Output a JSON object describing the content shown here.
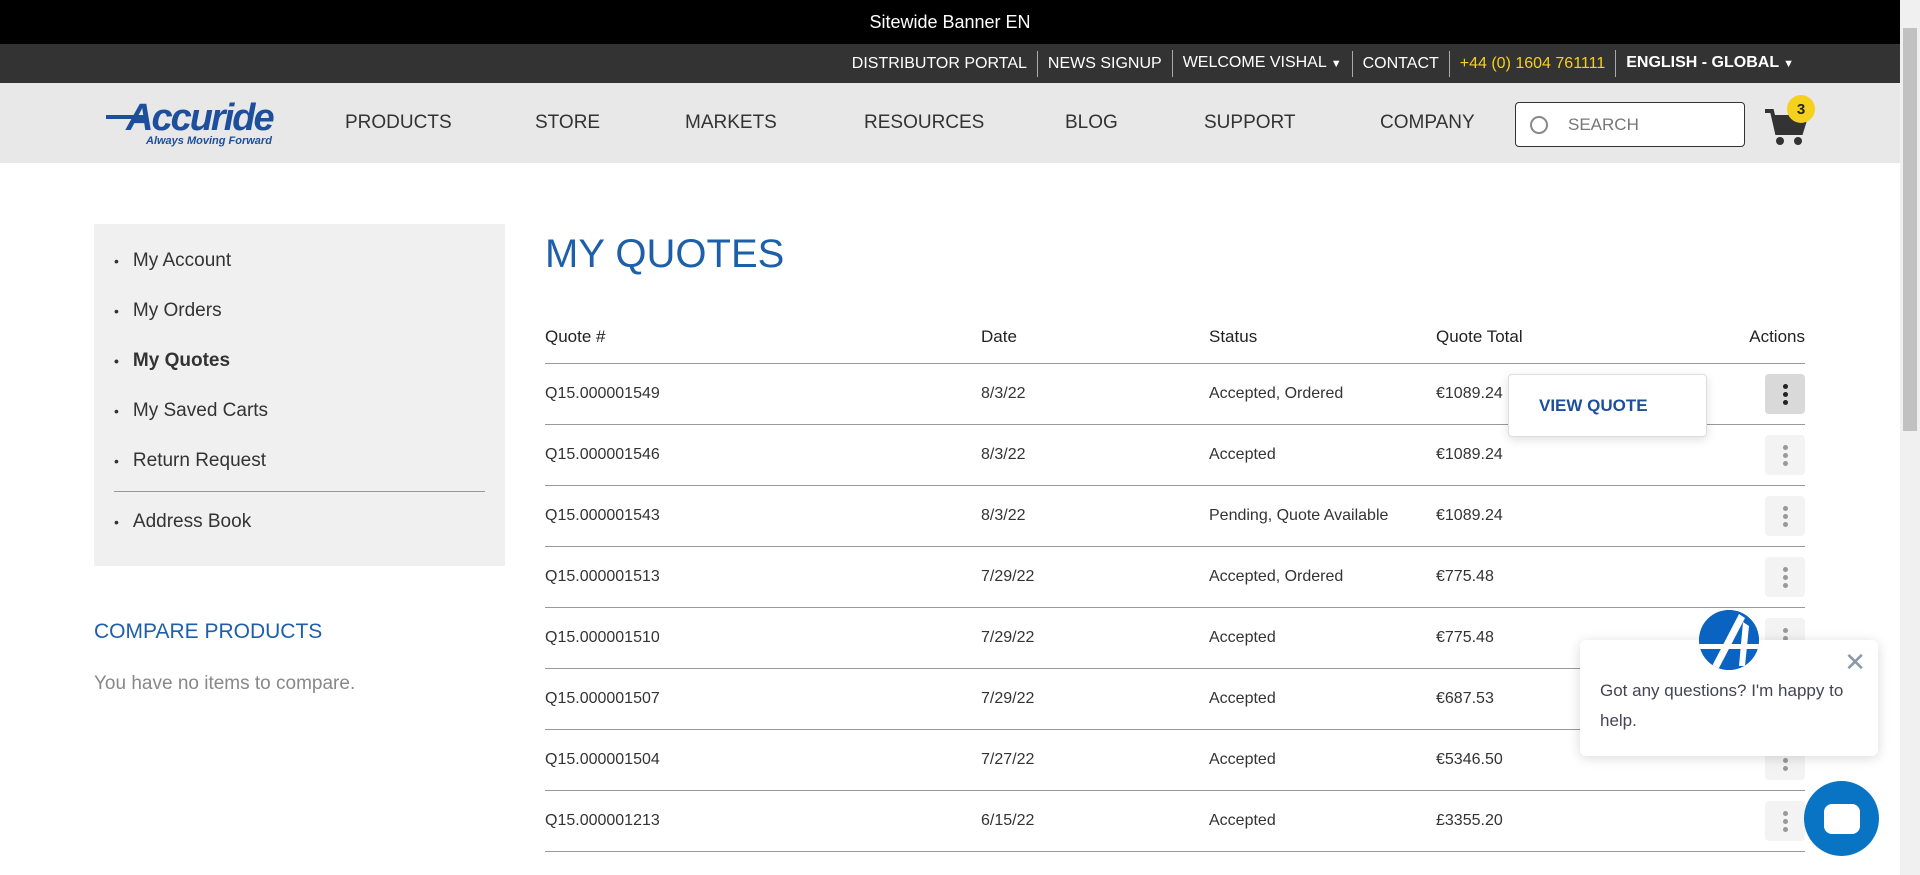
{
  "banner": "Sitewide Banner EN",
  "util": {
    "distributor": "DISTRIBUTOR PORTAL",
    "news": "NEWS SIGNUP",
    "welcome": "WELCOME VISHAL",
    "contact": "CONTACT",
    "phone": "+44 (0) 1604 761111",
    "language": "ENGLISH - GLOBAL"
  },
  "logo": {
    "name": "Accuride",
    "tagline": "Always Moving Forward"
  },
  "nav": [
    "PRODUCTS",
    "STORE",
    "MARKETS",
    "RESOURCES",
    "BLOG",
    "SUPPORT",
    "COMPANY"
  ],
  "search": {
    "placeholder": "SEARCH"
  },
  "cart": {
    "count": "3"
  },
  "sidebar": {
    "items": [
      "My Account",
      "My Orders",
      "My Quotes",
      "My Saved Carts",
      "Return Request",
      "Address Book"
    ],
    "active": "My Quotes"
  },
  "compare": {
    "title": "COMPARE PRODUCTS",
    "empty": "You have no items to compare."
  },
  "page_title": "MY QUOTES",
  "table": {
    "headers": [
      "Quote #",
      "Date",
      "Status",
      "Quote Total",
      "Actions"
    ],
    "rows": [
      [
        "Q15.000001549",
        "8/3/22",
        "Accepted, Ordered",
        "€1089.24"
      ],
      [
        "Q15.000001546",
        "8/3/22",
        "Accepted",
        "€1089.24"
      ],
      [
        "Q15.000001543",
        "8/3/22",
        "Pending, Quote Available",
        "€1089.24"
      ],
      [
        "Q15.000001513",
        "7/29/22",
        "Accepted, Ordered",
        "€775.48"
      ],
      [
        "Q15.000001510",
        "7/29/22",
        "Accepted",
        "€775.48"
      ],
      [
        "Q15.000001507",
        "7/29/22",
        "Accepted",
        "€687.53"
      ],
      [
        "Q15.000001504",
        "7/27/22",
        "Accepted",
        "€5346.50"
      ],
      [
        "Q15.000001213",
        "6/15/22",
        "Accepted",
        "£3355.20"
      ]
    ]
  },
  "actions_menu": {
    "view_quote": "VIEW QUOTE"
  },
  "chat": {
    "message": "Got any questions? I'm happy to help."
  },
  "colors": {
    "brand_blue": "#1d5fa8",
    "accent_yellow": "#f5d01c"
  }
}
